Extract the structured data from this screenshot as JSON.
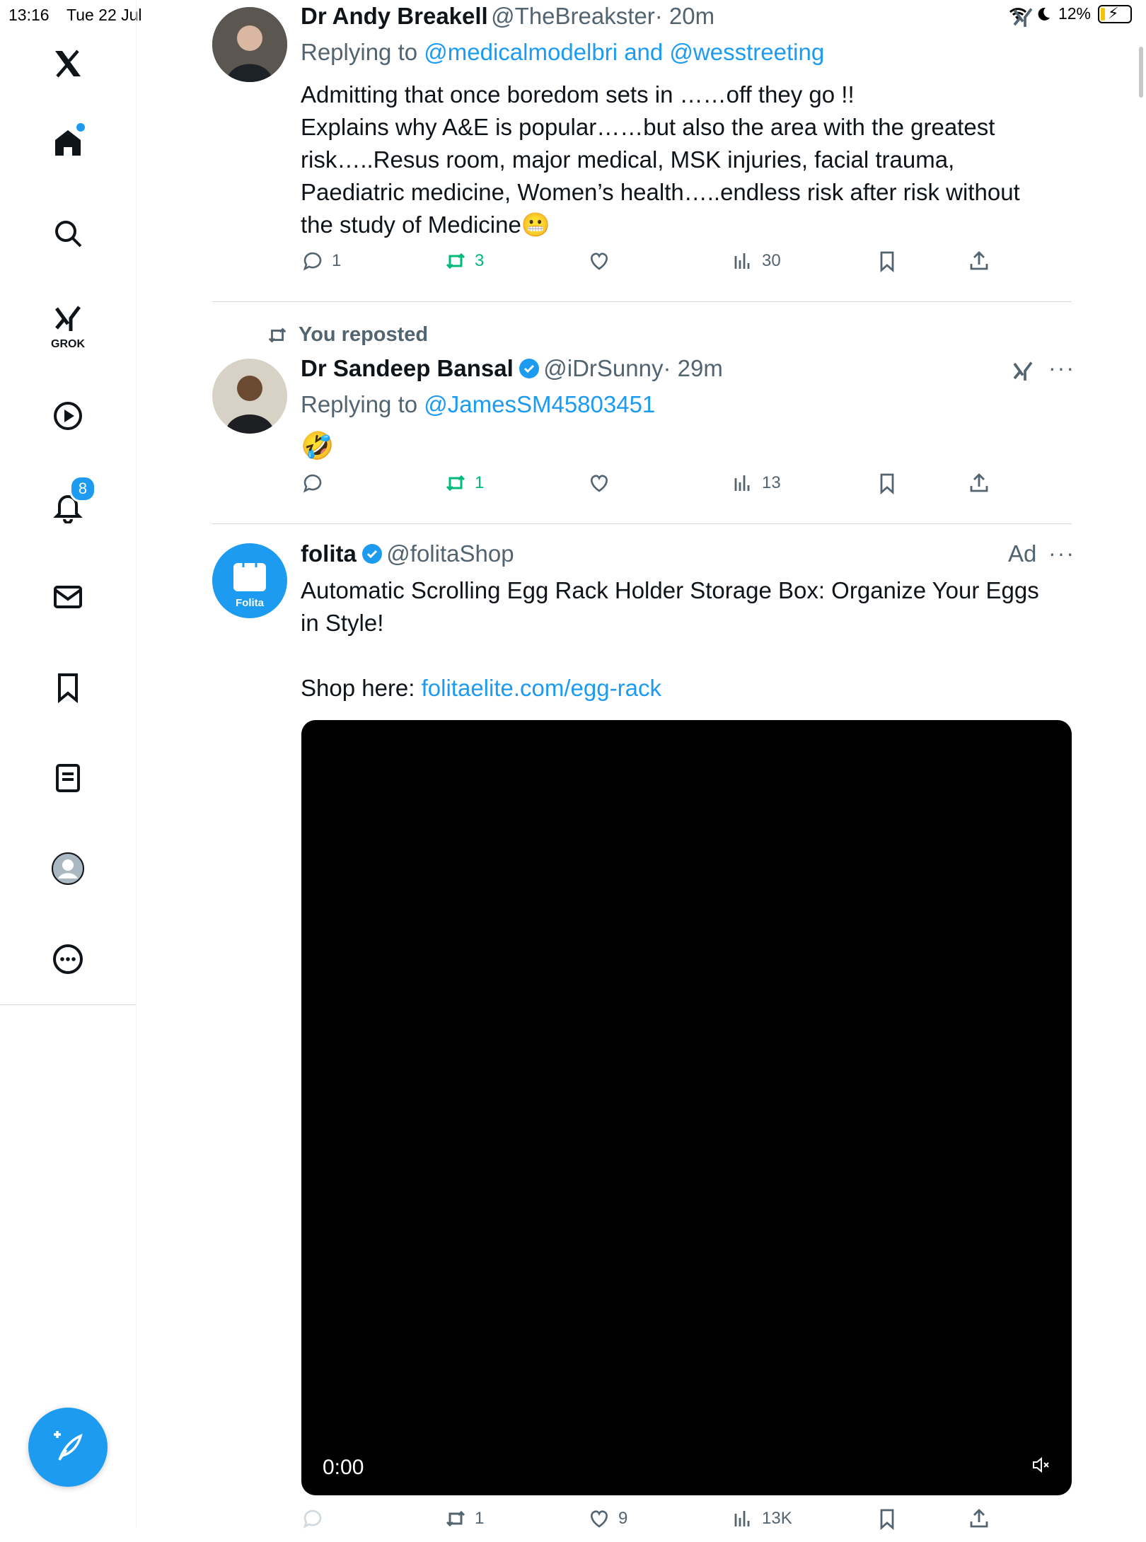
{
  "status_bar": {
    "time": "13:16",
    "date": "Tue 22 Jul",
    "battery": "12%"
  },
  "sidebar": {
    "notifications_badge": "8",
    "grok_label": "GROK"
  },
  "colors": {
    "accent": "#1d9bf0",
    "repost_green": "#00ba7c",
    "muted": "#536471"
  },
  "tweet1": {
    "name": "Dr Andy Breakell",
    "handle": "@TheBreakster",
    "time": "· 20m",
    "replying_prefix": "Replying to ",
    "replying_to": "@medicalmodelbri and @wesstreeting",
    "lines": [
      "Admitting that once boredom sets in ……off they go !!",
      "Explains why A&E is popular……but also the area with the greatest",
      "risk…..Resus room, major medical, MSK injuries, facial trauma,",
      "Paediatric medicine, Women’s health…..endless risk after risk without",
      "the study of Medicine😬"
    ],
    "replies": "1",
    "reposts": "3",
    "likes": "",
    "views": "30"
  },
  "tweet2": {
    "repost_note": "You reposted",
    "name": "Dr Sandeep Bansal",
    "handle": "@iDrSunny",
    "time": "· 29m",
    "replying_prefix": "Replying to ",
    "replying_to": "@JamesSM45803451",
    "text": "🤣",
    "replies": "",
    "reposts": "1",
    "likes": "",
    "views": "13",
    "more": "···"
  },
  "ad": {
    "name": "folita",
    "handle": "@folitaShop",
    "ad_label": "Ad",
    "more": "···",
    "avatar_text": "Folita",
    "headline_1": "Automatic Scrolling Egg Rack Holder Storage Box: Organize Your Eggs",
    "headline_2": "in Style!",
    "shop_prefix": "Shop here: ",
    "shop_link": "folitaelite.com/egg-rack",
    "video_time": "0:00",
    "replies": "",
    "reposts": "1",
    "likes": "9",
    "views": "13K"
  }
}
